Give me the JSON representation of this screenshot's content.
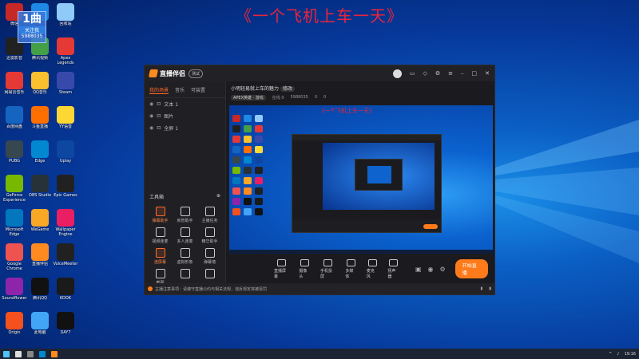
{
  "overlay_title": "《一个飞机上车一天》",
  "badge": {
    "big": "1曲",
    "tag": "关注我",
    "num": "5988035"
  },
  "desktop_icons": [
    {
      "label": "微信",
      "color": "#c62828"
    },
    {
      "label": "",
      "color": "#1e88e5"
    },
    {
      "label": "回收站",
      "color": "#90caf9"
    },
    {
      "label": "迅雷影音",
      "color": "#212121"
    },
    {
      "label": "腾讯视频",
      "color": "#43a047"
    },
    {
      "label": "Apex Legends",
      "color": "#e53935"
    },
    {
      "label": "网易云音乐",
      "color": "#e53935"
    },
    {
      "label": "QQ音乐",
      "color": "#fbc02d"
    },
    {
      "label": "Steam",
      "color": "#3949ab"
    },
    {
      "label": "百度网盘",
      "color": "#1565c0"
    },
    {
      "label": "斗鱼直播",
      "color": "#ff6f00"
    },
    {
      "label": "YY语音",
      "color": "#fdd835"
    },
    {
      "label": "PUBG",
      "color": "#37474f"
    },
    {
      "label": "Edge",
      "color": "#0288d1"
    },
    {
      "label": "Uplay",
      "color": "#0d47a1"
    },
    {
      "label": "GeForce Experience",
      "color": "#76b900"
    },
    {
      "label": "OBS Studio",
      "color": "#263238"
    },
    {
      "label": "Epic Games",
      "color": "#212121"
    },
    {
      "label": "Microsoft Edge",
      "color": "#0277bd"
    },
    {
      "label": "WeGame",
      "color": "#f9a825"
    },
    {
      "label": "Wallpaper Engine",
      "color": "#e91e63"
    },
    {
      "label": "Google Chrome",
      "color": "#ef5350"
    },
    {
      "label": "直播伴侣",
      "color": "#ff8a1f"
    },
    {
      "label": "VoiceMeeter",
      "color": "#212121"
    },
    {
      "label": "Soundflower",
      "color": "#8e24aa"
    },
    {
      "label": "腾讯QQ",
      "color": "#111111"
    },
    {
      "label": "KOOK",
      "color": "#1a1a1a"
    },
    {
      "label": "Origin",
      "color": "#f4511e"
    },
    {
      "label": "此电脑",
      "color": "#42a5f5"
    },
    {
      "label": "DAY7",
      "color": "#111111"
    }
  ],
  "app": {
    "name": "直播伴侣",
    "version_tag": "测试",
    "left_tabs": [
      "我的场景",
      "音乐",
      "可装置"
    ],
    "scenes": [
      "文本 1",
      "图片",
      "全屏 1"
    ],
    "tools_header": "工具箱",
    "tools": [
      {
        "label": "弹幕助手",
        "hot": true
      },
      {
        "label": "房管助手",
        "hot": false
      },
      {
        "label": "主播任务",
        "hot": false
      },
      {
        "label": "视频连麦",
        "hot": false
      },
      {
        "label": "多人连麦",
        "hot": false
      },
      {
        "label": "精华助手",
        "hot": false
      },
      {
        "label": "连屏幕",
        "hot": true
      },
      {
        "label": "虚拟形象",
        "hot": false
      },
      {
        "label": "弹幕墙",
        "hot": false
      },
      {
        "label": "截图",
        "hot": false
      },
      {
        "label": "",
        "hot": false
      },
      {
        "label": "",
        "hot": false
      }
    ],
    "room_title": "小明轻易就上车的魅力",
    "room_chip": "修改",
    "room_meta": [
      "APEX英雄 · 游戏",
      "在线 0",
      "5988035",
      "0",
      "0"
    ],
    "preview_title": "《一个飞机上车一天》",
    "bottom_buttons": [
      "直播屏幕",
      "摄像头",
      "手机投屏",
      "多媒体",
      "麦克风",
      "扬声器"
    ],
    "go_live": "开始直播",
    "status_text": "主播注意事项：请遵守直播公约与相关法规，违反规定将被惩罚"
  },
  "taskbar_time": "19:16",
  "colors": {
    "accent": "#ff7a1a",
    "overlay_red": "#e8253c"
  }
}
